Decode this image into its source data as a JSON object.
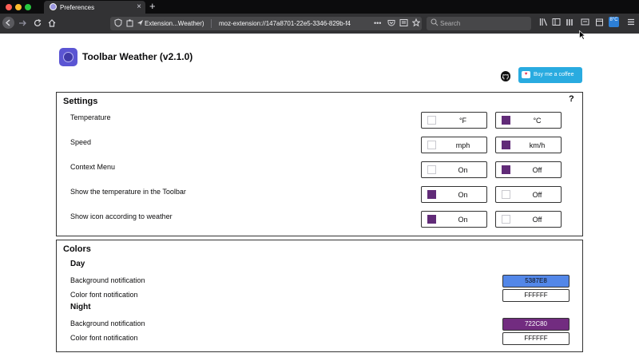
{
  "browser": {
    "tab_title": "Preferences",
    "tab_close": "×",
    "new_tab": "+",
    "extension_label": "Extension...Weather)",
    "url": "moz-extension://147a8701-22e5-3346-829b-f4",
    "search_placeholder": "Search",
    "more_icon": "•••",
    "ext_badge": "8°C",
    "icons": {
      "back": "back-icon",
      "forward": "forward-icon",
      "reload": "reload-icon",
      "home": "home-icon",
      "library": "library-icon",
      "sidebar": "sidebar-icon",
      "menu": "hamburger-menu-icon"
    }
  },
  "app": {
    "title": "Toolbar Weather (v2.1.0)",
    "coffee_label": "Buy me a coffee"
  },
  "settings": {
    "title": "Settings",
    "help": "?",
    "rows": [
      {
        "label": "Temperature",
        "opt1": "°F",
        "opt1_checked": false,
        "opt2": "°C",
        "opt2_checked": true
      },
      {
        "label": "Speed",
        "opt1": "mph",
        "opt1_checked": false,
        "opt2": "km/h",
        "opt2_checked": true
      },
      {
        "label": "Context Menu",
        "opt1": "On",
        "opt1_checked": false,
        "opt2": "Off",
        "opt2_checked": true
      },
      {
        "label": "Show the temperature in the Toolbar",
        "opt1": "On",
        "opt1_checked": true,
        "opt2": "Off",
        "opt2_checked": false
      },
      {
        "label": "Show icon according to weather",
        "opt1": "On",
        "opt1_checked": true,
        "opt2": "Off",
        "opt2_checked": false
      }
    ]
  },
  "colors": {
    "title": "Colors",
    "day": {
      "title": "Day",
      "bg_label": "Background notification",
      "bg_value": "5387E8",
      "font_label": "Color font notification",
      "font_value": "FFFFFF"
    },
    "night": {
      "title": "Night",
      "bg_label": "Background notification",
      "bg_value": "722C80",
      "font_label": "Color font notification",
      "font_value": "FFFFFF"
    }
  },
  "palette": {
    "checked": "#612b78",
    "day_bg": "#5387e8",
    "night_bg": "#722c80",
    "coffee": "#29abe0"
  }
}
